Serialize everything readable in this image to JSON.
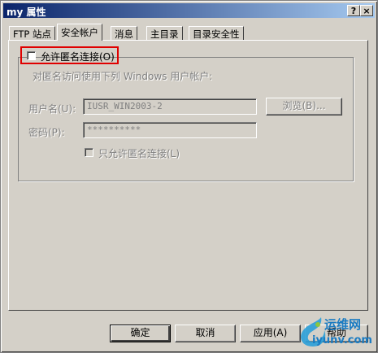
{
  "window": {
    "title": "my 属性",
    "help_button": "?",
    "close_button": "×"
  },
  "tabs": [
    {
      "label": "FTP 站点",
      "active": false
    },
    {
      "label": "安全帐户",
      "active": true
    },
    {
      "label": "消息",
      "active": false
    },
    {
      "label": "主目录",
      "active": false
    },
    {
      "label": "目录安全性",
      "active": false
    }
  ],
  "security": {
    "allow_anonymous_label": "允许匿名连接(O)",
    "allow_anonymous_checked": false,
    "description": "对匿名访问使用下列 Windows 用户帐户:",
    "username_label": "用户名(U):",
    "username_value": "IUSR_WIN2003-2",
    "browse_button": "浏览(B)...",
    "password_label": "密码(P):",
    "password_value": "**********",
    "only_anonymous_label": "只允许匿名连接(L)",
    "only_anonymous_checked": false
  },
  "footer": {
    "ok": "确定",
    "cancel": "取消",
    "apply": "应用(A)",
    "help": "帮助"
  },
  "watermark": {
    "line1": "运维网",
    "line2": "iyunv.com"
  },
  "colors": {
    "highlight": "#e00000",
    "face": "#d4d0c8",
    "title_start": "#0a246a",
    "title_end": "#a6caf0"
  }
}
